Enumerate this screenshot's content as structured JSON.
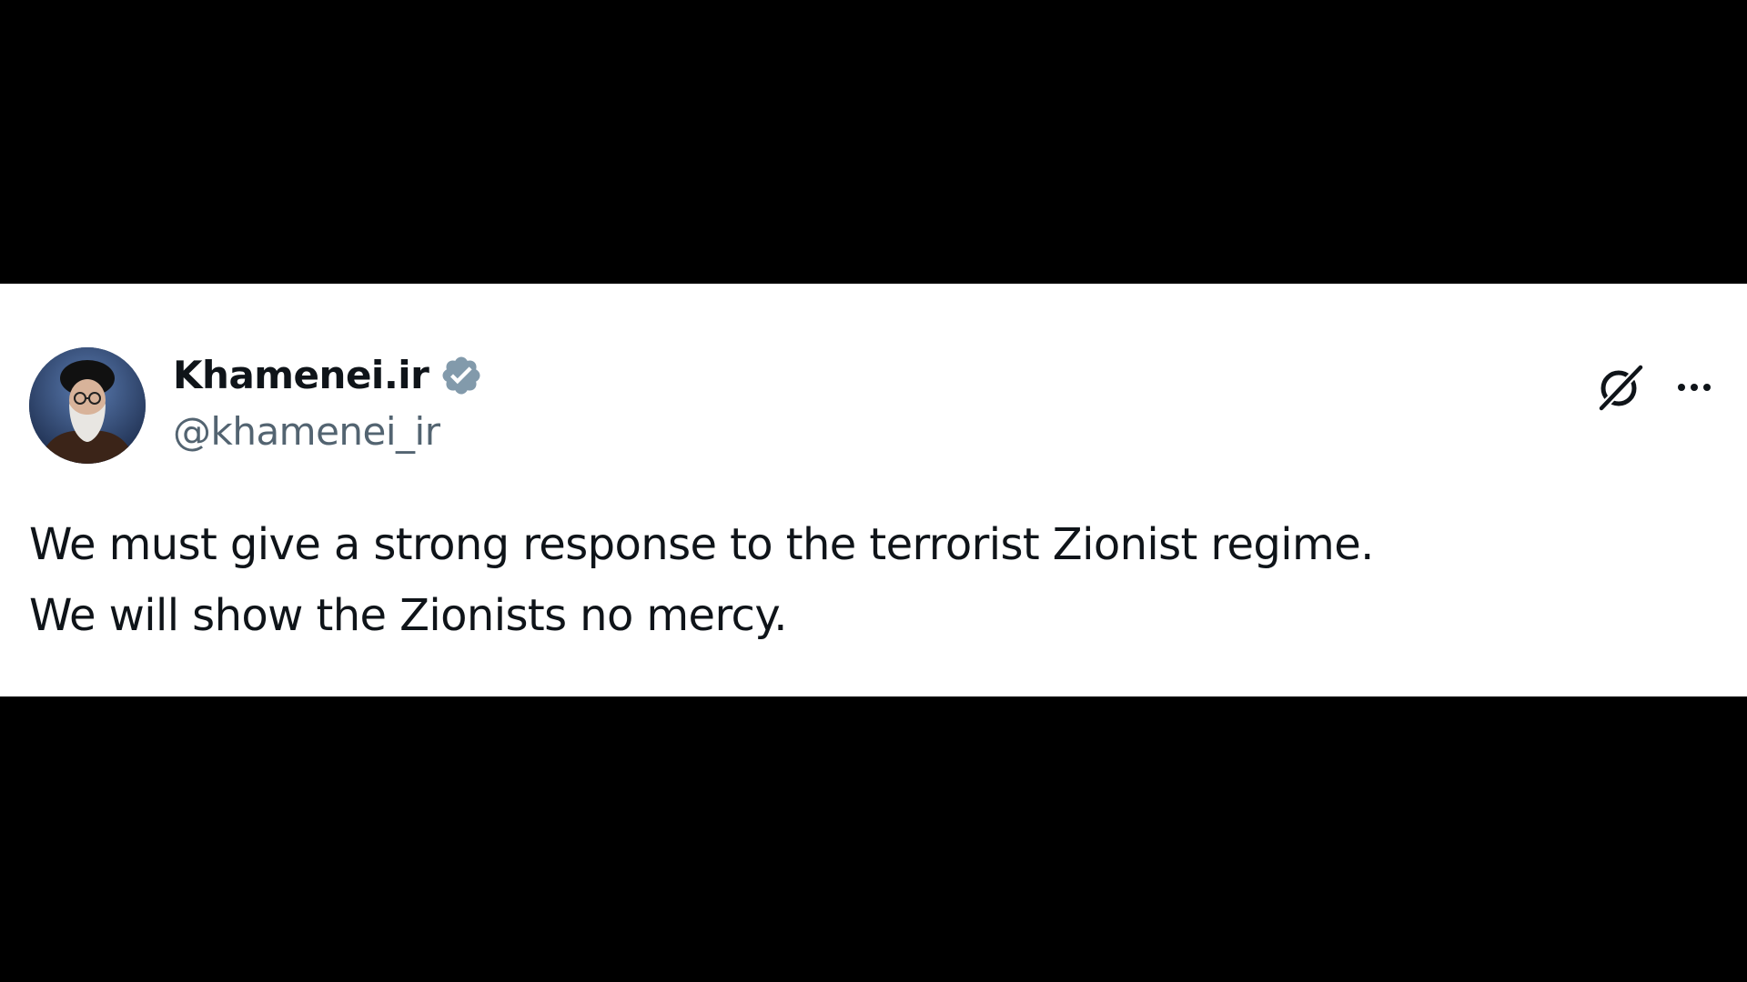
{
  "tweet": {
    "display_name": "Khamenei.ir",
    "handle": "@khamenei_ir",
    "verified": true,
    "text_lines": [
      "We must give a strong response to the terrorist Zionist regime.",
      "We will show the Zionists no mercy."
    ]
  },
  "icons": {
    "avatar": "profile-photo",
    "verified": "verified-badge-icon",
    "grok": "grok-icon",
    "more": "more-options-icon"
  },
  "colors": {
    "background": "#000000",
    "card": "#ffffff",
    "text": "#0f1419",
    "handle": "#536471",
    "verified_badge": "#829aab"
  }
}
